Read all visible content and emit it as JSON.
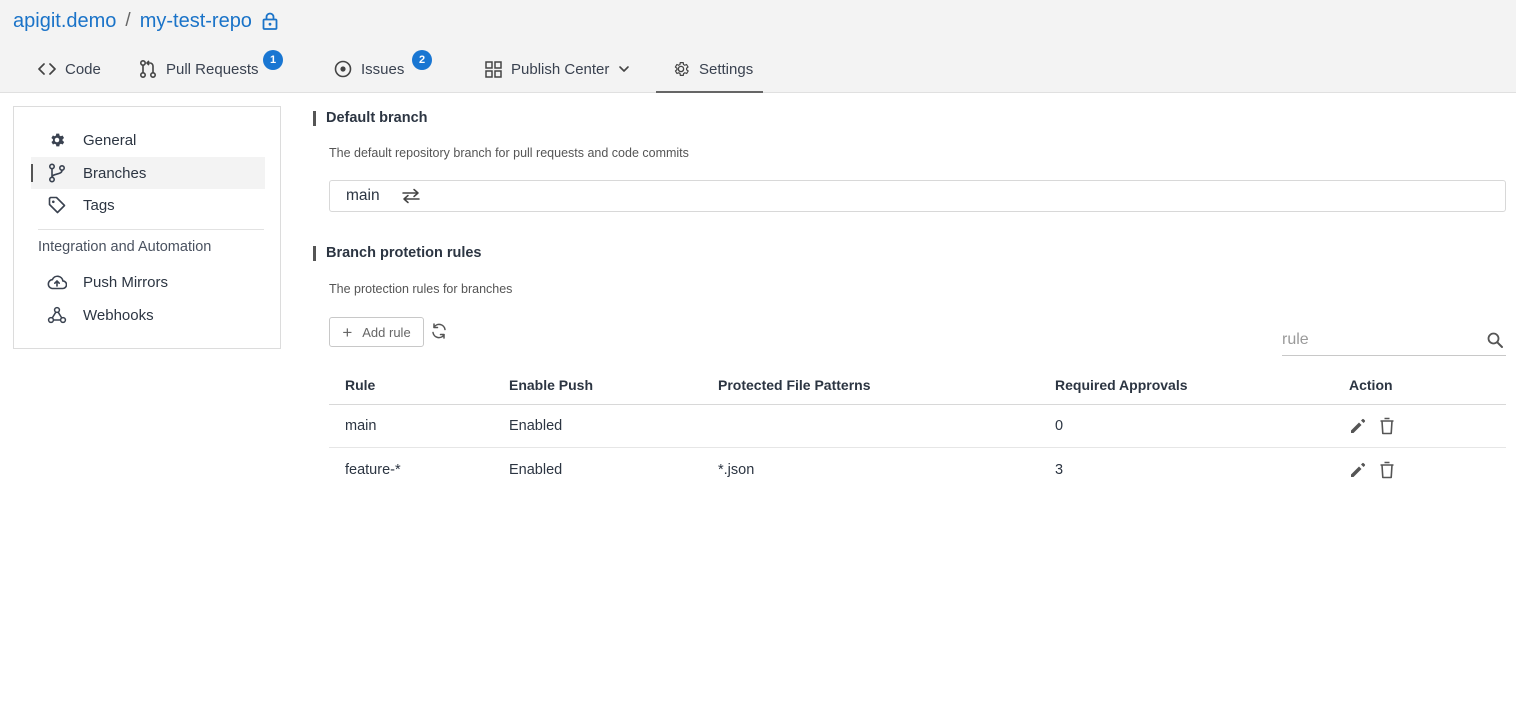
{
  "repo": {
    "owner": "apigit.demo",
    "separator": "/",
    "name": "my-test-repo",
    "visibility_icon": "lock-icon"
  },
  "tabs": [
    {
      "label": "Code",
      "icon": "code-icon"
    },
    {
      "label": "Pull Requests",
      "icon": "pull-request-icon",
      "badge": "1"
    },
    {
      "label": "Issues",
      "icon": "issue-icon",
      "badge": "2"
    },
    {
      "label": "Publish Center",
      "icon": "grid-icon"
    },
    {
      "label": "Settings",
      "icon": "gear-icon",
      "active": true
    }
  ],
  "sidebar": {
    "items": [
      {
        "label": "General",
        "icon": "gear-icon"
      },
      {
        "label": "Branches",
        "icon": "branch-icon",
        "active": true
      },
      {
        "label": "Tags",
        "icon": "tag-icon"
      }
    ],
    "section_label": "Integration and Automation",
    "integration_items": [
      {
        "label": "Push Mirrors",
        "icon": "cloud-upload-icon"
      },
      {
        "label": "Webhooks",
        "icon": "webhook-icon"
      }
    ]
  },
  "default_branch": {
    "title": "Default branch",
    "description": "The default repository branch for pull requests and code commits",
    "value": "main"
  },
  "protection": {
    "title": "Branch protetion rules",
    "description": "The protection rules for branches",
    "add_label": "Add rule",
    "search_placeholder": "rule",
    "columns": [
      "Rule",
      "Enable Push",
      "Protected File Patterns",
      "Required Approvals",
      "Action"
    ],
    "rows": [
      {
        "rule": "main",
        "enable_push": "Enabled",
        "patterns": "",
        "approvals": "0"
      },
      {
        "rule": "feature-*",
        "enable_push": "Enabled",
        "patterns": "*.json",
        "approvals": "3"
      }
    ]
  },
  "colors": {
    "accent": "#1a73c8",
    "badge": "#1976d2",
    "header_bg": "#f3f3f3"
  }
}
